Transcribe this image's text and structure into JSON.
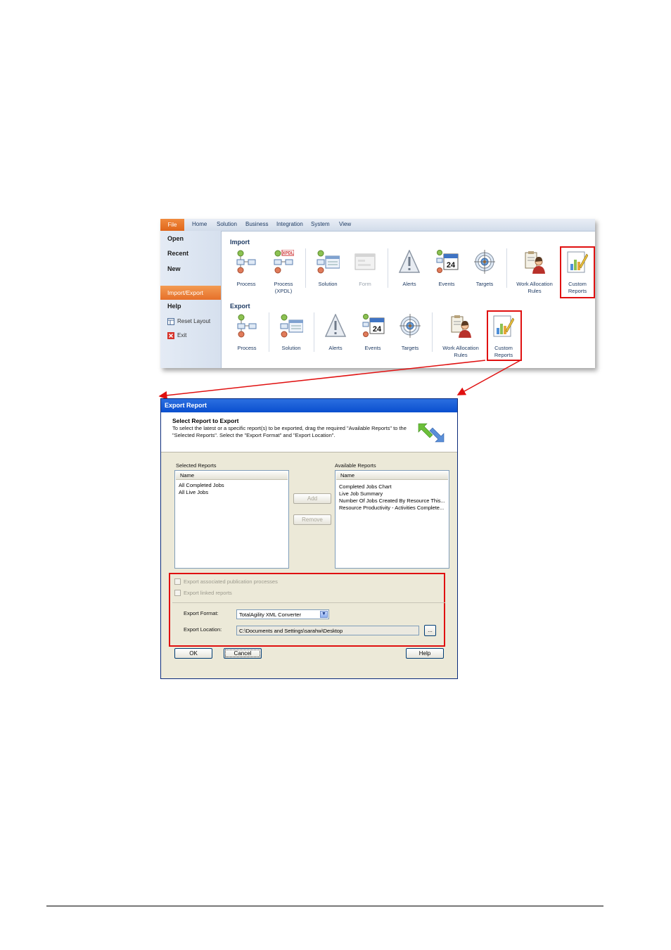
{
  "ribbon": {
    "tabs": [
      "File",
      "Home",
      "Solution",
      "Business",
      "Integration",
      "System",
      "View"
    ],
    "nav": {
      "open": "Open",
      "recent": "Recent",
      "new": "New",
      "import_export": "Import/Export",
      "help": "Help",
      "reset_layout": "Reset Layout",
      "exit": "Exit"
    },
    "import_title": "Import",
    "import_buttons": [
      {
        "label": "Process",
        "sub": "",
        "icon": "process-icon"
      },
      {
        "label": "Process",
        "sub": "(XPDL)",
        "icon": "process-xpdl-icon"
      },
      {
        "label": "Solution",
        "sub": "",
        "icon": "solution-icon"
      },
      {
        "label": "Form",
        "sub": "",
        "icon": "form-icon",
        "disabled": true
      },
      {
        "label": "Alerts",
        "sub": "",
        "icon": "alert-icon"
      },
      {
        "label": "Events",
        "sub": "",
        "icon": "calendar-icon"
      },
      {
        "label": "Targets",
        "sub": "",
        "icon": "target-icon"
      },
      {
        "label": "Work Allocation",
        "sub": "Rules",
        "icon": "work-allocation-icon"
      },
      {
        "label": "Custom",
        "sub": "Reports",
        "icon": "custom-reports-icon"
      }
    ],
    "export_title": "Export",
    "export_buttons": [
      {
        "label": "Process",
        "sub": "",
        "icon": "process-icon"
      },
      {
        "label": "Solution",
        "sub": "",
        "icon": "solution-icon"
      },
      {
        "label": "Alerts",
        "sub": "",
        "icon": "alert-icon"
      },
      {
        "label": "Events",
        "sub": "",
        "icon": "calendar-icon"
      },
      {
        "label": "Targets",
        "sub": "",
        "icon": "target-icon"
      },
      {
        "label": "Work Allocation",
        "sub": "Rules",
        "icon": "work-allocation-icon"
      },
      {
        "label": "Custom",
        "sub": "Reports",
        "icon": "custom-reports-icon"
      }
    ],
    "calendar_day": "24",
    "xpdl_tag": "XPDL"
  },
  "dialog": {
    "title": "Export Report",
    "header_title": "Select Report to Export",
    "header_text": "To select the latest or a specific report(s) to be exported, drag the required \"Available Reports\" to the \"Selected Reports\". Select the \"Export Format\" and \"Export Location\".",
    "selected_label": "Selected Reports",
    "available_label": "Available Reports",
    "column_name": "Name",
    "selected_items": [
      "All Completed Jobs",
      "All Live Jobs"
    ],
    "available_items": [
      "Completed Jobs Chart",
      "Live Job Summary",
      "Number Of Jobs Created By Resource This...",
      "Resource Productivity - Activities Complete..."
    ],
    "add_label": "Add",
    "remove_label": "Remove",
    "chk_publication": "Export associated publication processes",
    "chk_linked": "Export linked reports",
    "format_label": "Export Format:",
    "format_value": "TotalAgility XML Converter",
    "location_label": "Export Location:",
    "location_value": "C:\\Documents and Settings\\sarahw\\Desktop",
    "browse_label": "...",
    "ok_label": "OK",
    "cancel_label": "Cancel",
    "help_label": "Help"
  },
  "colors": {
    "highlight": "#e01010",
    "titlebar": "#0a4fcf",
    "file_tab": "#e6702a"
  }
}
